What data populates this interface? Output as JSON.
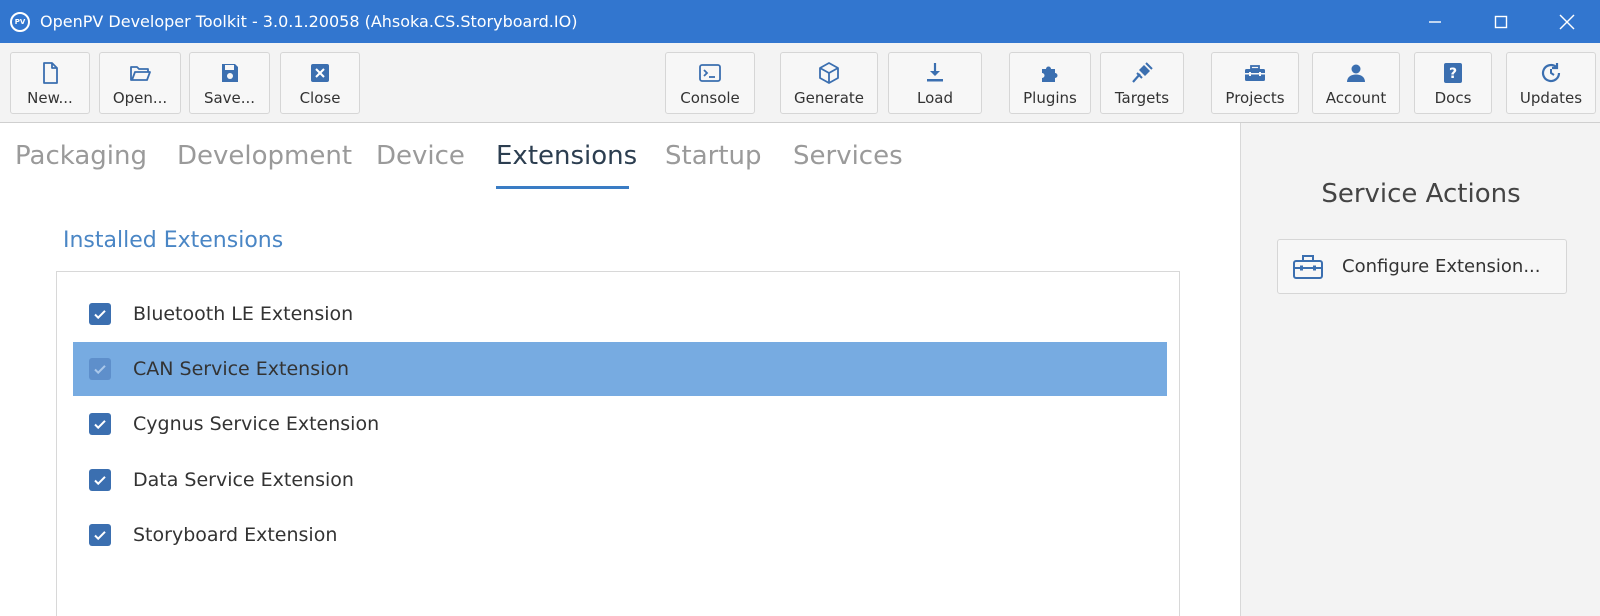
{
  "window": {
    "title": "OpenPV Developer Toolkit - 3.0.1.20058 (Ahsoka.CS.Storyboard.IO)",
    "logo_text": "PV"
  },
  "toolbar": {
    "new_label": "New...",
    "open_label": "Open...",
    "save_label": "Save...",
    "close_label": "Close",
    "console_label": "Console",
    "generate_label": "Generate",
    "load_label": "Load",
    "plugins_label": "Plugins",
    "targets_label": "Targets",
    "projects_label": "Projects",
    "account_label": "Account",
    "docs_label": "Docs",
    "updates_label": "Updates"
  },
  "tabs": [
    {
      "label": "Packaging"
    },
    {
      "label": "Development"
    },
    {
      "label": "Device"
    },
    {
      "label": "Extensions"
    },
    {
      "label": "Startup"
    },
    {
      "label": "Services"
    }
  ],
  "active_tab": "Extensions",
  "main": {
    "section_title": "Installed Extensions",
    "extensions": [
      {
        "label": "Bluetooth LE Extension",
        "checked": true,
        "selected": false
      },
      {
        "label": "CAN Service Extension",
        "checked": true,
        "selected": true
      },
      {
        "label": "Cygnus Service Extension",
        "checked": true,
        "selected": false
      },
      {
        "label": "Data Service Extension",
        "checked": true,
        "selected": false
      },
      {
        "label": "Storyboard Extension",
        "checked": true,
        "selected": false
      }
    ]
  },
  "side_panel": {
    "title": "Service Actions",
    "configure_label": "Configure Extension..."
  },
  "colors": {
    "accent": "#3276cf",
    "selected_row": "#77abe1",
    "checkbox": "#3b6fb0",
    "section_title": "#4a86c5"
  }
}
